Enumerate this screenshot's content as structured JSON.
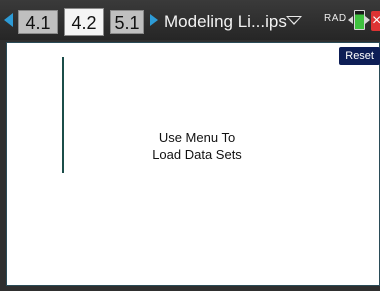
{
  "tabs": [
    {
      "label": "4.1",
      "active": false
    },
    {
      "label": "4.2",
      "active": true
    },
    {
      "label": "5.1",
      "active": false
    }
  ],
  "document": {
    "title": "Modeling Li...ips"
  },
  "status": {
    "angle_mode": "RAD"
  },
  "colors": {
    "accent_arrow": "#2d9bd6",
    "reset_bg": "#0d1e56",
    "close": "#dd3333",
    "battery": "#3fc23f"
  },
  "workspace": {
    "reset_label": "Reset",
    "message_line1": "Use Menu To",
    "message_line2": "Load Data Sets"
  },
  "icons": {
    "prev": "chevron-left-icon",
    "next": "chevron-right-icon",
    "menu": "caret-down-icon",
    "battery": "battery-icon",
    "close": "close-icon"
  }
}
